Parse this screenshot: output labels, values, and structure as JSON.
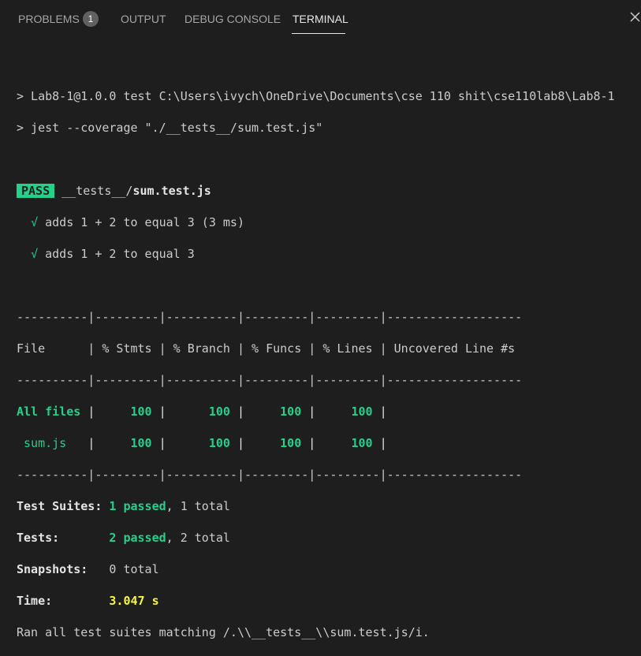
{
  "tabs": {
    "problems": "PROBLEMS",
    "problems_count": "1",
    "output": "OUTPUT",
    "debug_console": "DEBUG CONSOLE",
    "terminal": "TERMINAL"
  },
  "terminal": {
    "cmd1": "> Lab8-1@1.0.0 test C:\\Users\\ivych\\OneDrive\\Documents\\cse 110 shit\\cse110lab8\\Lab8-1",
    "cmd2": "> jest --coverage \"./__tests__/sum.test.js\"",
    "pass_label": "PASS",
    "test_dir": "__tests__/",
    "test_file": "sum.test.js",
    "checkmark": "√",
    "test1": "adds 1 + 2 to equal 3 (3 ms)",
    "test2": "adds 1 + 2 to equal 3",
    "sep": "----------|---------|----------|---------|---------|-------------------",
    "header": "File      | % Stmts | % Branch | % Funcs | % Lines | Uncovered Line #s ",
    "row_all": {
      "file": "All files ",
      "stmts": "100",
      "branch": "100",
      "funcs": "100",
      "lines": "100"
    },
    "row_sum": {
      "file": " sum.js   ",
      "stmts": "100",
      "branch": "100",
      "funcs": "100",
      "lines": "100"
    },
    "suites_label": "Test Suites:",
    "suites_passed": "1 passed",
    "suites_total": ", 1 total",
    "tests_label": "Tests:",
    "tests_passed": "2 passed",
    "tests_total": ", 2 total",
    "snapshots_label": "Snapshots:",
    "snapshots_value": "0 total",
    "time_label": "Time:",
    "time_value": "3.047 s",
    "ran_all": "Ran all test suites matching /.\\\\__tests__\\\\sum.test.js/i."
  },
  "colors": {
    "background": "#1e1e1e",
    "pass_green": "#23d18b",
    "time_yellow": "#f5f543"
  }
}
